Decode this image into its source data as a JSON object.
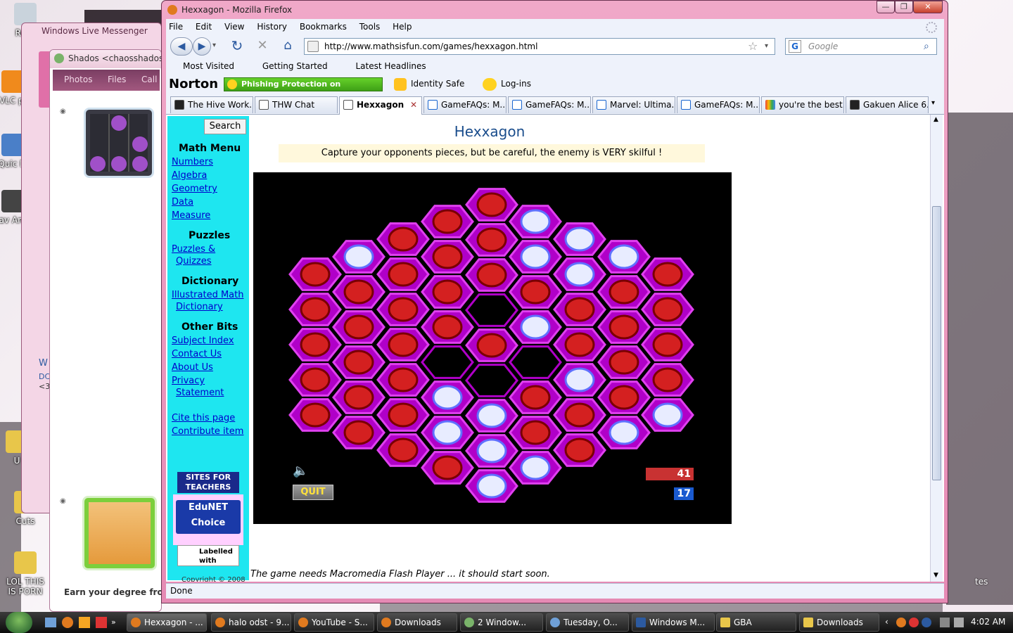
{
  "desktop": {
    "icons": [
      {
        "label": "Recy"
      },
      {
        "label": "VLC pl"
      },
      {
        "label": "Quic Pl"
      },
      {
        "label": "av Ant"
      },
      {
        "label": "U"
      },
      {
        "label": "Cuts"
      },
      {
        "label": "LOL THIS IS PORN"
      }
    ],
    "right_edge_label": "tes"
  },
  "messenger": {
    "title": "Windows Live Messenger",
    "chat_title": "Shados <chaosshados@",
    "nav": [
      "Photos",
      "Files",
      "Call"
    ],
    "side_texts": [
      "W",
      "DC",
      "<3"
    ],
    "promo": "Earn your degree from U"
  },
  "firefox": {
    "title": "Hexxagon - Mozilla Firefox",
    "menu": [
      "File",
      "Edit",
      "View",
      "History",
      "Bookmarks",
      "Tools",
      "Help"
    ],
    "url": "http://www.mathsisfun.com/games/hexxagon.html",
    "search_placeholder": "Google",
    "bookmarks": [
      "Most Visited",
      "Getting Started",
      "Latest Headlines"
    ],
    "norton": {
      "brand": "Norton",
      "phishing": "Phishing Protection on",
      "identity": "Identity Safe",
      "logins": "Log-ins"
    },
    "tabs": [
      {
        "label": "The Hive Work..."
      },
      {
        "label": "THW Chat"
      },
      {
        "label": "Hexxagon",
        "active": true
      },
      {
        "label": "GameFAQs: M..."
      },
      {
        "label": "GameFAQs: M..."
      },
      {
        "label": "Marvel: Ultima..."
      },
      {
        "label": "GameFAQs: M..."
      },
      {
        "label": "you're the best..."
      },
      {
        "label": "Gakuen Alice 6..."
      }
    ],
    "status": "Done"
  },
  "page": {
    "search_button": "Search",
    "title": "Hexxagon",
    "notice": "Capture your opponents pieces, but be careful, the enemy is VERY skilful !",
    "footnote": "The game needs Macromedia Flash Player ... it should start soon.",
    "sidebar": {
      "math_menu": "Math Menu",
      "math_links": [
        "Numbers",
        "Algebra",
        "Geometry",
        "Data",
        "Measure"
      ],
      "puzzles": "Puzzles",
      "puzzle_link_1": "Puzzles &",
      "puzzle_link_2": "Quizzes",
      "dictionary": "Dictionary",
      "dict_link_1": "Illustrated Math",
      "dict_link_2": "Dictionary",
      "other": "Other Bits",
      "other_links": [
        "Subject Index",
        "Contact Us",
        "About Us"
      ],
      "privacy_1": "Privacy",
      "privacy_2": "Statement",
      "cite": "Cite this page",
      "contribute": "Contribute item",
      "badge_1": "SITES FOR TEACHERS",
      "badge_2": "EduNET Choice",
      "badge_3": "Labelled with",
      "copyright": "Copyright © 2008"
    },
    "game": {
      "quit": "QUIT",
      "red_score": "41",
      "blue_score": "17",
      "red_color": "#d42020",
      "white_color": "#e8ecff",
      "board_color": "#b000c8"
    }
  },
  "taskbar": {
    "items": [
      {
        "label": "Hexxagon - ...",
        "active": true
      },
      {
        "label": "halo odst - 9..."
      },
      {
        "label": "YouTube - S..."
      },
      {
        "label": "Downloads"
      },
      {
        "label": "2 Window..."
      },
      {
        "label": "Tuesday, O..."
      },
      {
        "label": "Windows M..."
      },
      {
        "label": "GBA"
      },
      {
        "label": "Downloads"
      }
    ],
    "clock": "4:02 AM"
  }
}
